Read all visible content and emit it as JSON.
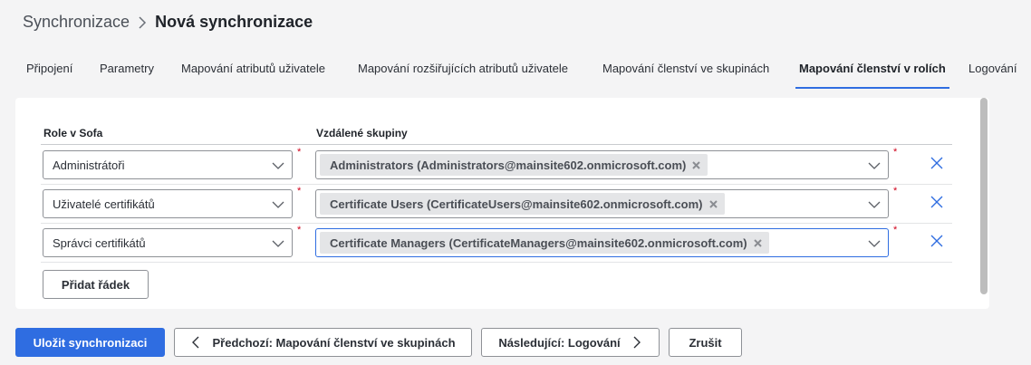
{
  "breadcrumb": {
    "parent": "Synchronizace",
    "current": "Nová synchronizace"
  },
  "tabs": [
    {
      "label": "Připojení"
    },
    {
      "label": "Parametry"
    },
    {
      "label": "Mapování atributů uživatele"
    },
    {
      "label": "Mapování rozšiřujících atributů uživatele"
    },
    {
      "label": "Mapování členství ve skupinách"
    },
    {
      "label": "Mapování členství v rolích",
      "active": true
    },
    {
      "label": "Logování"
    }
  ],
  "table": {
    "col_role": "Role v Sofa",
    "col_groups": "Vzdálené skupiny",
    "required_mark": "*",
    "rows": [
      {
        "role": "Administrátoři",
        "group": "Administrators (Administrators@mainsite602.onmicrosoft.com)"
      },
      {
        "role": "Uživatelé certifikátů",
        "group": "Certificate Users (CertificateUsers@mainsite602.onmicrosoft.com)"
      },
      {
        "role": "Správci certifikátů",
        "group": "Certificate Managers (CertificateManagers@mainsite602.onmicrosoft.com)"
      }
    ],
    "add_row_label": "Přidat řádek"
  },
  "footer": {
    "save_label": "Uložit synchronizaci",
    "prev_label": "Předchozí: Mapování členství ve skupinách",
    "next_label": "Následující: Logování",
    "cancel_label": "Zrušit"
  },
  "colors": {
    "accent": "#2f6de1",
    "required": "#d0021b"
  },
  "icons": [
    "chevron-right-icon",
    "chevron-down-icon",
    "chip-remove-icon",
    "delete-row-icon",
    "chevron-left-icon"
  ]
}
